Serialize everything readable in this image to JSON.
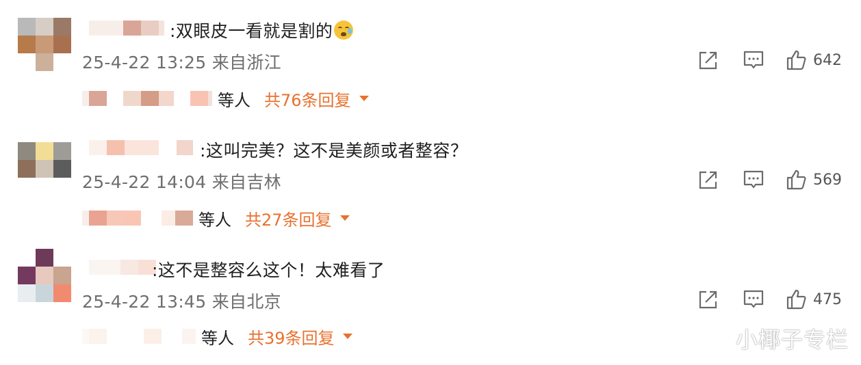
{
  "comments": [
    {
      "text": ":双眼皮一看就是割的",
      "emoji": "crying-face-emoji",
      "date": "25-4-22 13:25",
      "location": "来自浙江",
      "likes": "642",
      "reply_suffix": "等人",
      "reply_count": "共76条回复"
    },
    {
      "text": ":这叫完美？这不是美颜或者整容？",
      "date": "25-4-22 14:04",
      "location": "来自吉林",
      "likes": "569",
      "reply_suffix": "等人",
      "reply_count": "共27条回复"
    },
    {
      "text": ":这不是整容么这个！太难看了",
      "date": "25-4-22 13:45",
      "location": "来自北京",
      "likes": "475",
      "reply_suffix": "等人",
      "reply_count": "共39条回复"
    }
  ],
  "watermark": "小椰子专栏",
  "colors": {
    "accent": "#e8712e",
    "meta_text": "#6e6e6e",
    "icon_stroke": "#6a6a6a"
  }
}
